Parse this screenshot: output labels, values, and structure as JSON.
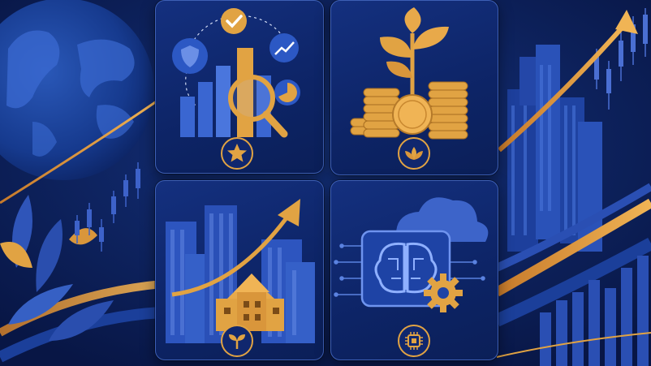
{
  "palette": {
    "background": "#0a1a4f",
    "panel": "#0f2870",
    "accent_gold": "#e1a343",
    "accent_blue": "#3d62c9"
  },
  "tiles": [
    {
      "id": "analytics",
      "icons": [
        "checkmark-icon",
        "shield-icon",
        "trend-up-icon",
        "pie-chart-icon",
        "bar-chart-icon",
        "magnifier-icon"
      ],
      "badge_icon": "star-icon"
    },
    {
      "id": "growth",
      "icons": [
        "sprout-icon",
        "coin-stack-icon"
      ],
      "badge_icon": "lotus-icon"
    },
    {
      "id": "real-estate",
      "icons": [
        "skyscraper-icon",
        "house-icon",
        "trend-arrow-icon"
      ],
      "badge_icon": "seedling-icon"
    },
    {
      "id": "ai-tech",
      "icons": [
        "cloud-icon",
        "brain-circuit-icon",
        "gear-icon"
      ],
      "badge_icon": "chip-icon"
    }
  ]
}
